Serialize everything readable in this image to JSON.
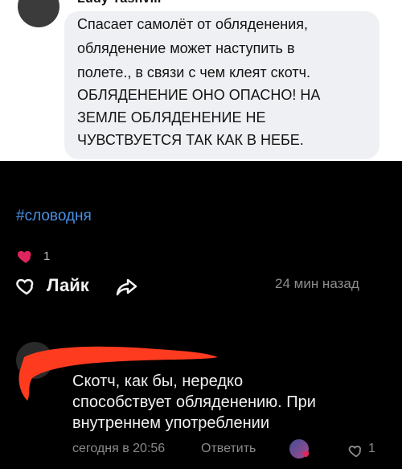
{
  "top": {
    "author_partial": "Ludy Yashvili",
    "bubble_lines": [
      "Спасает самолёт от обляденения,",
      "обляденение может наступить в",
      "полете., в связи с чем клеят скотч.",
      "ОБЛЯДЕНЕНИЕ ОНО ОПАСНО! НА",
      "ЗЕМЛЕ ОБЛЯДЕНЕНИЕ НЕ",
      "ЧУВСТВУЕТСЯ ТАК КАК В  НЕБЕ."
    ]
  },
  "post": {
    "hashtag": "#словодня",
    "likes_count": "1",
    "like_label": "Лайк",
    "time_ago": "24 мин назад"
  },
  "comment": {
    "text_lines": [
      "Скотч, как бы, нередко",
      "способствует обляденению. При",
      "внутреннем употреблении"
    ],
    "time": "сегодня в 20:56",
    "reply_label": "Ответить",
    "likes_count": "1"
  },
  "colors": {
    "accent_link": "#4a90e2",
    "heart": "#e0245e",
    "redaction": "#ff3b1f"
  }
}
